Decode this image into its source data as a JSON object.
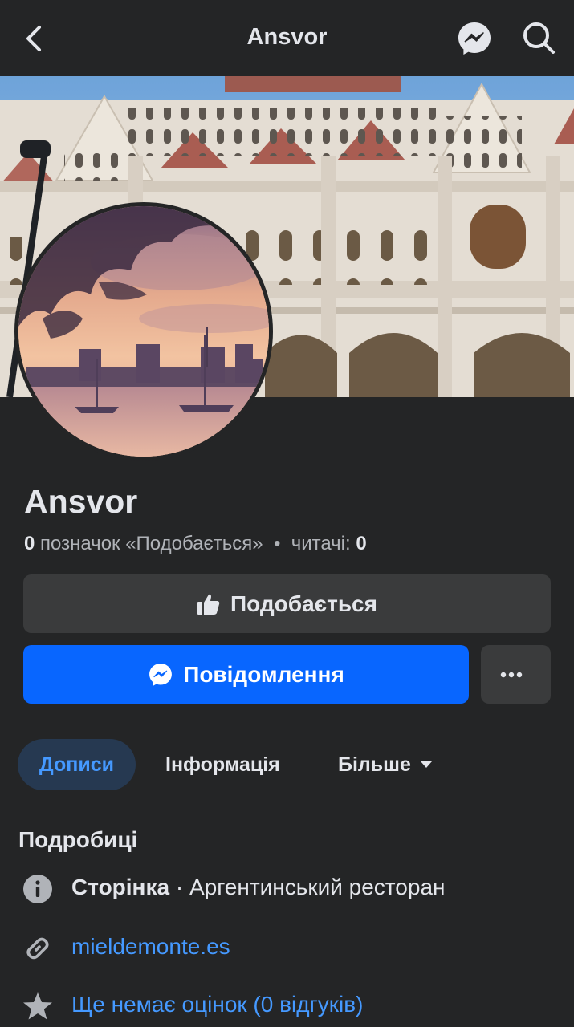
{
  "header": {
    "title": "Ansvor",
    "back_icon": "chevron-left-icon",
    "messenger_icon": "messenger-icon",
    "search_icon": "search-icon"
  },
  "profile": {
    "name": "Ansvor",
    "likes_count": "0",
    "likes_label": "позначок «Подобається»",
    "separator": "•",
    "followers_label": "читачі:",
    "followers_count": "0"
  },
  "actions": {
    "like_label": "Подобається",
    "message_label": "Повідомлення",
    "more_label": "···"
  },
  "tabs": [
    {
      "label": "Дописи",
      "active": true
    },
    {
      "label": "Інформація",
      "active": false
    },
    {
      "label": "Більше",
      "active": false
    }
  ],
  "details": {
    "title": "Подробиці",
    "category_prefix": "Сторінка",
    "category": " · Аргентинський ресторан",
    "website": "mieldemonte.es",
    "rating": "Ще немає оцінок (0 відгуків)"
  },
  "colors": {
    "background": "#242526",
    "accent": "#0866ff",
    "link": "#4599ff",
    "button_secondary": "#3a3b3c"
  }
}
